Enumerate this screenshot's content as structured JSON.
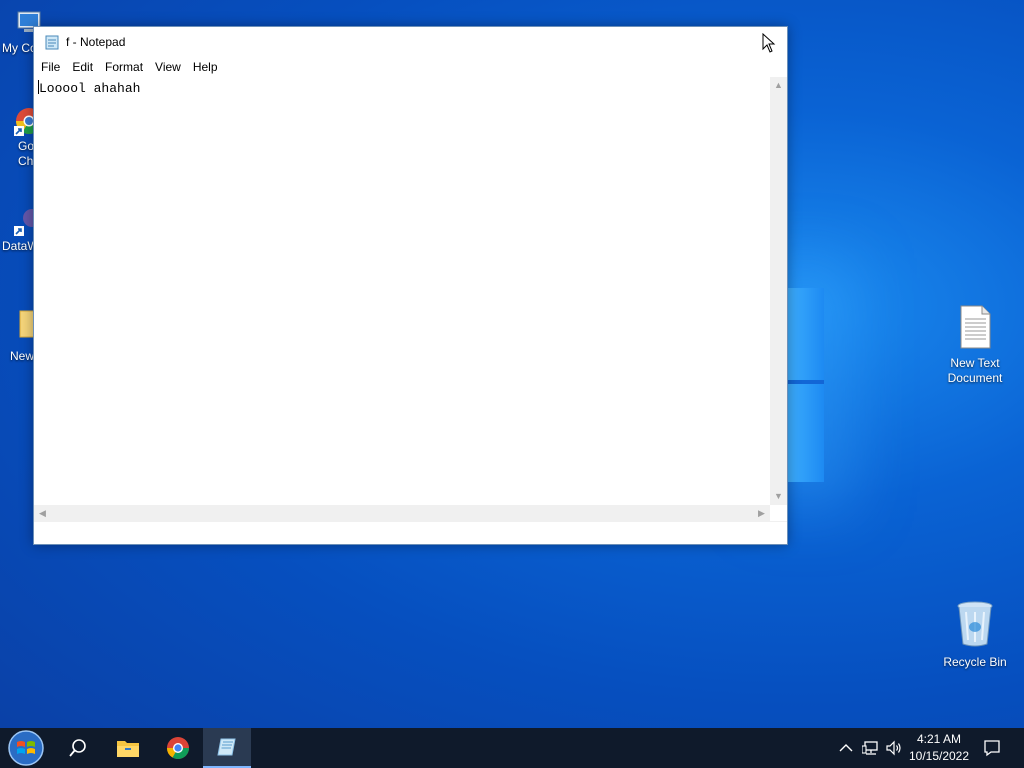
{
  "desktop": {
    "left_icons": [
      {
        "label": "My Co",
        "icon": "computer-icon"
      },
      {
        "label": "Go\nCh",
        "icon": "chrome-shortcut-icon"
      },
      {
        "label": "DataW",
        "icon": "app-shortcut-icon"
      },
      {
        "label": "New",
        "icon": "folder-icon"
      }
    ],
    "new_text_document": {
      "label_line1": "New Text",
      "label_line2": "Document",
      "icon": "text-document-icon"
    },
    "recycle_bin": {
      "label": "Recycle Bin",
      "icon": "recycle-bin-icon"
    }
  },
  "notepad": {
    "title": "f - Notepad",
    "menu": [
      "File",
      "Edit",
      "Format",
      "View",
      "Help"
    ],
    "content": "Looool ahahah"
  },
  "taskbar": {
    "apps": [
      "start-icon",
      "search-icon",
      "file-explorer-icon",
      "chrome-icon",
      "notepad-icon"
    ],
    "active_app": "notepad-icon",
    "time": "4:21 AM",
    "date": "10/15/2022"
  },
  "colors": {
    "taskbar_bg": "#0f1a2b",
    "desktop_blue": "#0a63d4",
    "active_underline": "#7fb6ff"
  }
}
